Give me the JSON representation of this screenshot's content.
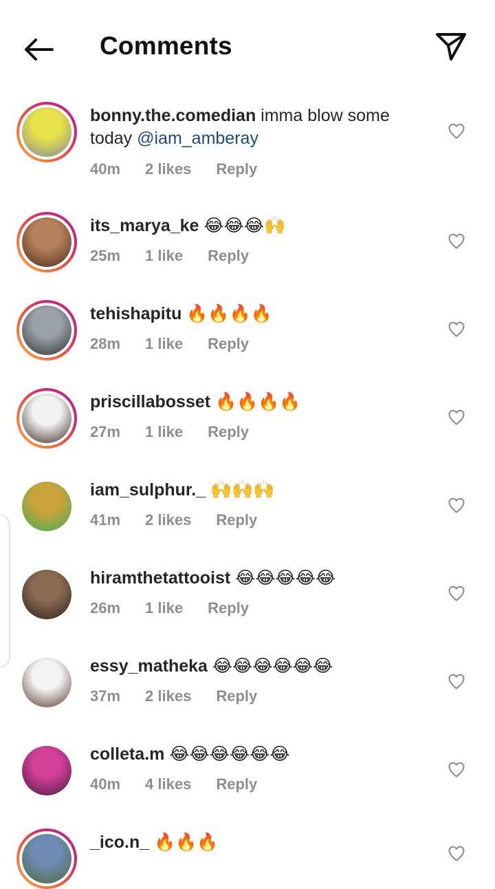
{
  "header": {
    "title": "Comments",
    "back_icon": "arrow-left-icon",
    "share_icon": "paper-plane-icon"
  },
  "comments": [
    {
      "username": "bonny.the.comedian",
      "text": " imma blow some today ",
      "mention": "@iam_amberay",
      "time": "40m",
      "likes": "2 likes",
      "reply": "Reply",
      "story_ring": true,
      "avatar_colors": [
        "#e8e24a",
        "#7e8a98"
      ]
    },
    {
      "username": "its_marya_ke",
      "text": " 😂😂😂🙌",
      "time": "25m",
      "likes": "1 like",
      "reply": "Reply",
      "story_ring": true,
      "avatar_colors": [
        "#b5805a",
        "#4a2c1f"
      ]
    },
    {
      "username": "tehishapitu",
      "text": " 🔥🔥🔥🔥",
      "time": "28m",
      "likes": "1 like",
      "reply": "Reply",
      "story_ring": true,
      "avatar_colors": [
        "#9aa2a8",
        "#2f3336"
      ]
    },
    {
      "username": "priscillabosset",
      "text": " 🔥🔥🔥🔥",
      "time": "27m",
      "likes": "1 like",
      "reply": "Reply",
      "story_ring": true,
      "avatar_colors": [
        "#f2f2f2",
        "#3a2b24"
      ]
    },
    {
      "username": "iam_sulphur._",
      "text": " 🙌🙌🙌",
      "time": "41m",
      "likes": "2 likes",
      "reply": "Reply",
      "story_ring": false,
      "avatar_colors": [
        "#caa33a",
        "#3fae57"
      ]
    },
    {
      "username": "hiramthetattooist",
      "text": " 😂😂😂😂😂",
      "time": "26m",
      "likes": "1 like",
      "reply": "Reply",
      "story_ring": false,
      "avatar_colors": [
        "#8a6a50",
        "#2a2420"
      ]
    },
    {
      "username": "essy_matheka",
      "text": " 😂😂😂😂😂😂",
      "time": "37m",
      "likes": "2 likes",
      "reply": "Reply",
      "story_ring": false,
      "avatar_colors": [
        "#f4f4f4",
        "#5a3a2c"
      ]
    },
    {
      "username": "colleta.m",
      "text": " 😂😂😂😂😂😂",
      "time": "40m",
      "likes": "4 likes",
      "reply": "Reply",
      "story_ring": false,
      "avatar_colors": [
        "#d23f98",
        "#4a1c40"
      ]
    },
    {
      "username": "_ico.n_",
      "text": " 🔥🔥🔥",
      "time": "",
      "likes": "",
      "reply": "",
      "story_ring": true,
      "avatar_colors": [
        "#6d8bb3",
        "#4f6b3a"
      ]
    }
  ]
}
